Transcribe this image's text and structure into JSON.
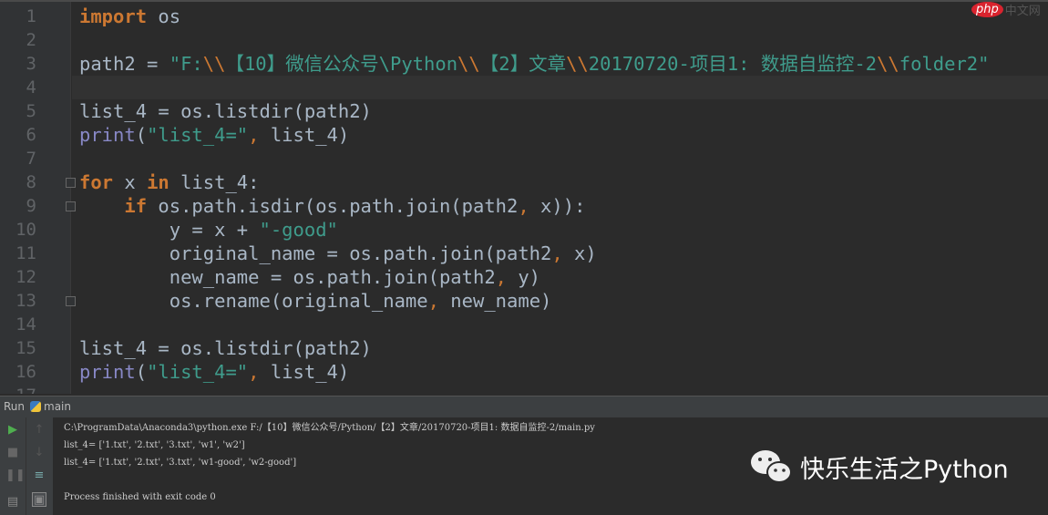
{
  "editor": {
    "current_line": 4,
    "fold_lines": [
      8,
      9,
      13
    ],
    "lines": [
      [
        [
          "import",
          "kw"
        ],
        [
          " os",
          ""
        ]
      ],
      [],
      [
        [
          "path2 = ",
          ""
        ],
        [
          "\"F:",
          "str"
        ],
        [
          "\\\\",
          "esc"
        ],
        [
          "【10】微信公众号\\Python",
          "str"
        ],
        [
          "\\\\",
          "esc"
        ],
        [
          "【2】文章",
          "str"
        ],
        [
          "\\\\",
          "esc"
        ],
        [
          "20170720-项目1: 数据自监控-2",
          "str"
        ],
        [
          "\\\\",
          "esc"
        ],
        [
          "folder2\"",
          "str"
        ]
      ],
      [],
      [
        [
          "list_4 = os.listdir(path2)",
          ""
        ]
      ],
      [
        [
          "print",
          "bi"
        ],
        [
          "(",
          ""
        ],
        [
          "\"list_4=\"",
          "str"
        ],
        [
          ",",
          "pn"
        ],
        [
          " list_4)",
          ""
        ]
      ],
      [],
      [
        [
          "for",
          "kw"
        ],
        [
          " x ",
          ""
        ],
        [
          "in",
          "kw"
        ],
        [
          " list_4:",
          ""
        ]
      ],
      [
        [
          "    ",
          ""
        ],
        [
          "if",
          "kw"
        ],
        [
          " os.path.isdir(os.path.join(path2",
          ""
        ],
        [
          ",",
          "pn"
        ],
        [
          " x)):",
          ""
        ]
      ],
      [
        [
          "        y = x + ",
          ""
        ],
        [
          "\"-good\"",
          "str"
        ]
      ],
      [
        [
          "        original_name = os.path.join(path2",
          ""
        ],
        [
          ",",
          "pn"
        ],
        [
          " x)",
          ""
        ]
      ],
      [
        [
          "        new_name = os.path.join(path2",
          ""
        ],
        [
          ",",
          "pn"
        ],
        [
          " y)",
          ""
        ]
      ],
      [
        [
          "        os.rename(original_name",
          ""
        ],
        [
          ",",
          "pn"
        ],
        [
          " new_name)",
          ""
        ]
      ],
      [],
      [
        [
          "list_4 = os.listdir(path2)",
          ""
        ]
      ],
      [
        [
          "print",
          "bi"
        ],
        [
          "(",
          ""
        ],
        [
          "\"list_4=\"",
          "str"
        ],
        [
          ",",
          "pn"
        ],
        [
          " list_4)",
          ""
        ]
      ],
      []
    ]
  },
  "run": {
    "label": "Run",
    "config": "main"
  },
  "console": {
    "lines": [
      "C:\\ProgramData\\Anaconda3\\python.exe F:/【10】微信公众号/Python/【2】文章/20170720-项目1: 数据自监控-2/main.py",
      "list_4= ['1.txt', '2.txt', '3.txt', 'w1', 'w2']",
      "list_4= ['1.txt', '2.txt', '3.txt', 'w1-good', 'w2-good']",
      "",
      "Process finished with exit code 0"
    ]
  },
  "watermark": {
    "text": "快乐生活之Python"
  },
  "logo": {
    "php": "php",
    "site": "中文网"
  }
}
